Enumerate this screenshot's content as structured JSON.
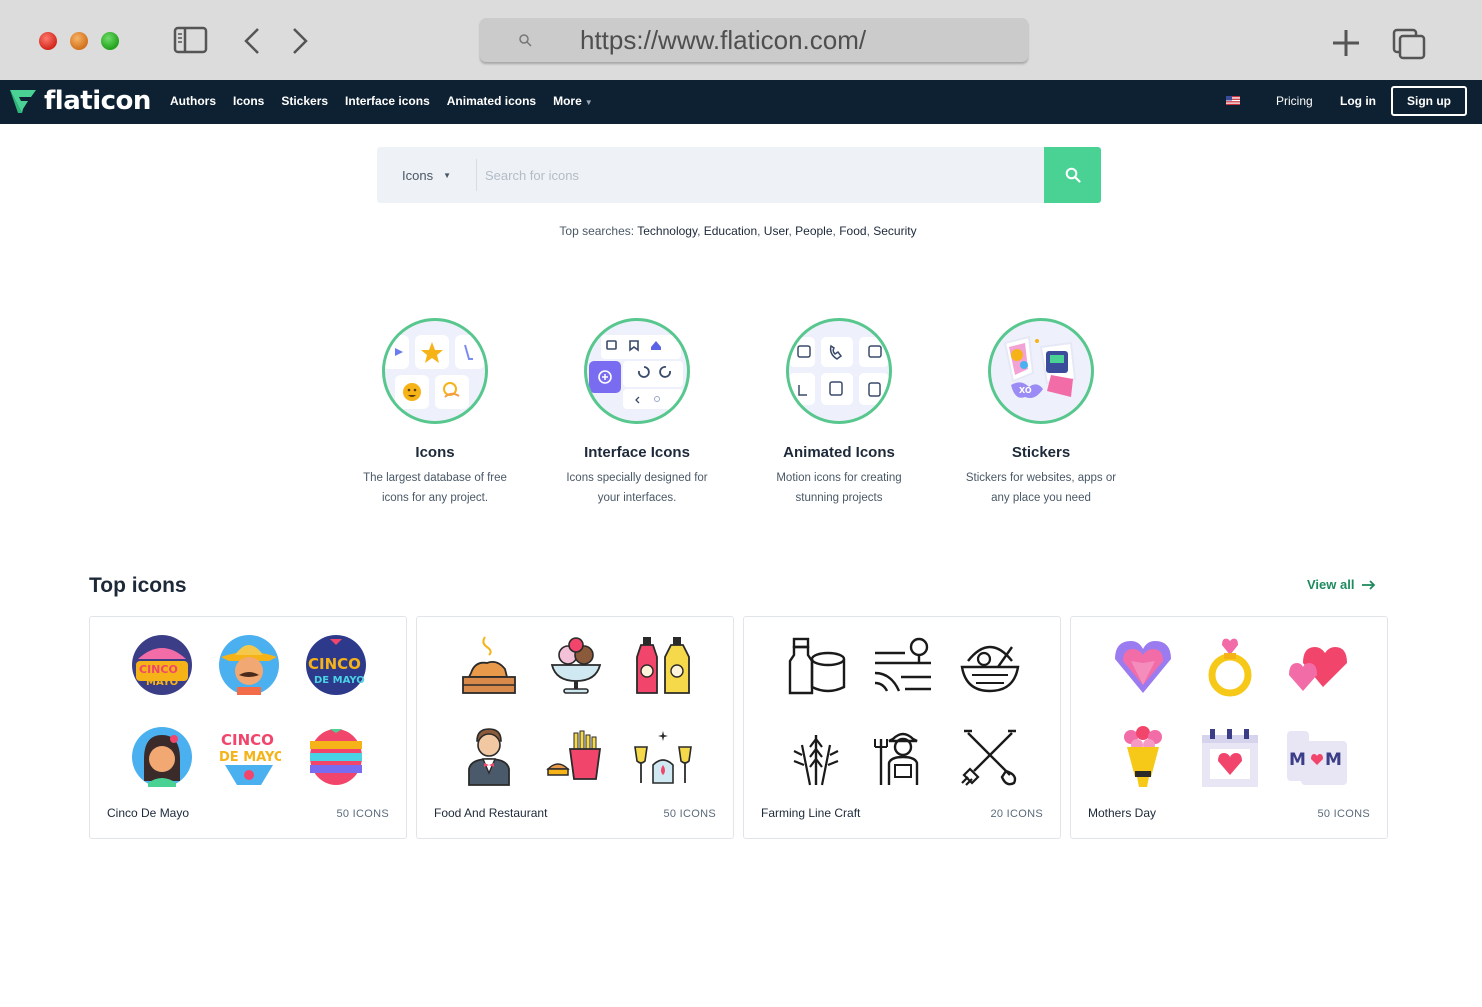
{
  "browser": {
    "url": "https://www.flaticon.com/"
  },
  "nav": {
    "logo_text": "flaticon",
    "links": [
      "Authors",
      "Icons",
      "Stickers",
      "Interface icons",
      "Animated icons",
      "More"
    ],
    "pricing": "Pricing",
    "login": "Log in",
    "signup": "Sign up"
  },
  "search": {
    "type_label": "Icons",
    "placeholder": "Search for icons",
    "top_label": "Top searches:",
    "top_terms": [
      "Technology",
      "Education",
      "User",
      "People",
      "Food",
      "Security"
    ]
  },
  "categories": [
    {
      "title": "Icons",
      "desc": "The largest database of free icons for any project."
    },
    {
      "title": "Interface Icons",
      "desc": "Icons specially designed for your interfaces."
    },
    {
      "title": "Animated Icons",
      "desc": "Motion icons for creating stunning projects"
    },
    {
      "title": "Stickers",
      "desc": "Stickers for websites, apps or any place you need"
    }
  ],
  "top_icons": {
    "title": "Top icons",
    "view_all": "View all",
    "packs": [
      {
        "name": "Cinco De Mayo",
        "count": "50 ICONS"
      },
      {
        "name": "Food And Restaurant",
        "count": "50 ICONS"
      },
      {
        "name": "Farming Line Craft",
        "count": "20 ICONS"
      },
      {
        "name": "Mothers Day",
        "count": "50 ICONS"
      }
    ]
  },
  "colors": {
    "nav_bg": "#0e2132",
    "accent": "#4ad295",
    "link_green": "#1f8a5e"
  }
}
